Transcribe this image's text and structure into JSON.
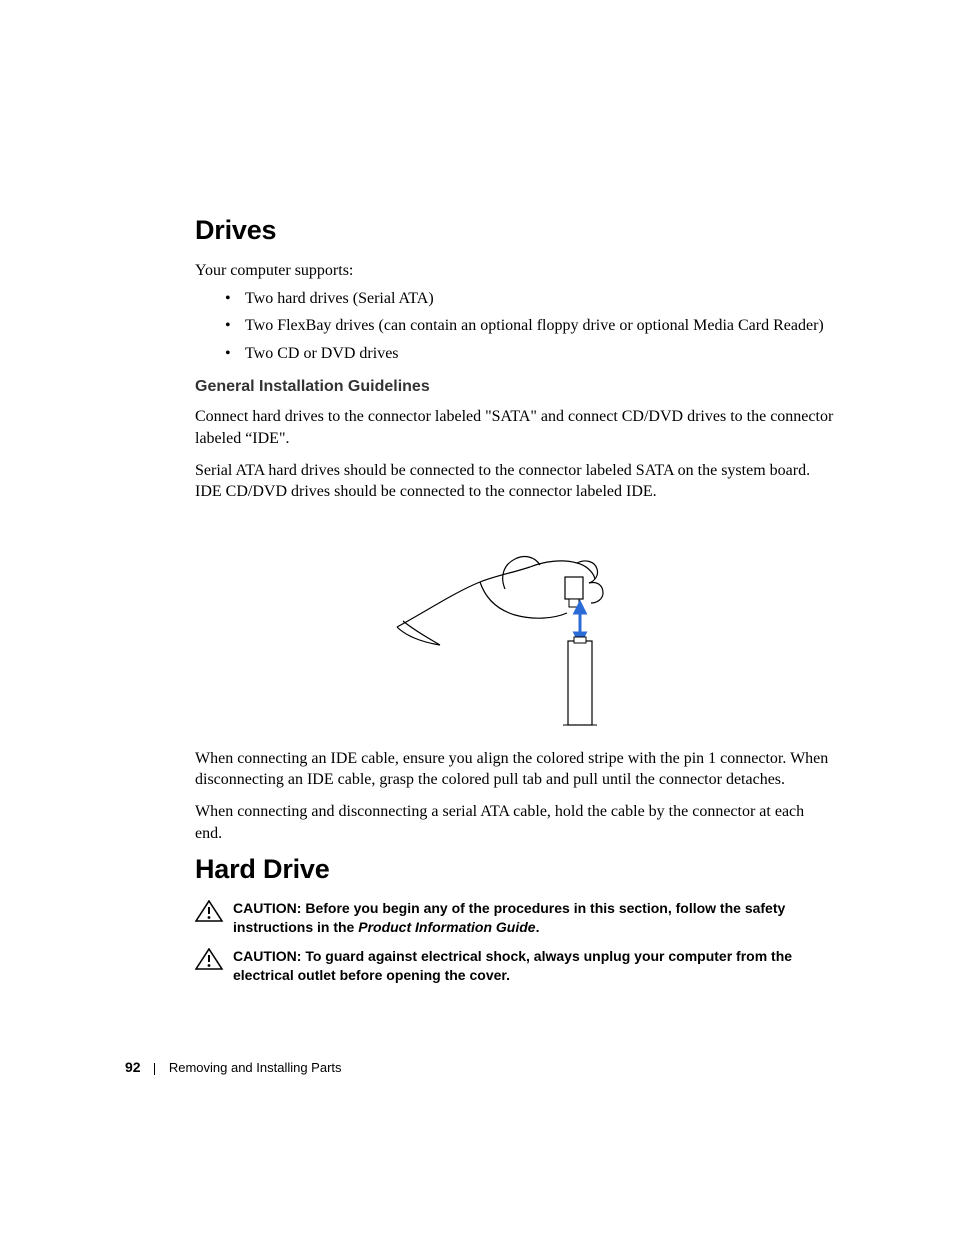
{
  "heading_drives": "Drives",
  "intro": "Your computer supports:",
  "bullets": [
    "Two hard drives (Serial ATA)",
    "Two FlexBay drives (can contain an optional floppy drive or optional Media Card Reader)",
    "Two CD or DVD drives"
  ],
  "subhead_guidelines": "General Installation Guidelines",
  "para1": "Connect hard drives to the connector labeled \"SATA\" and connect CD/DVD drives to the connector labeled “IDE\".",
  "para2": "Serial ATA hard drives should be connected to the connector labeled SATA on the system board. IDE CD/DVD drives should be connected to the connector labeled IDE.",
  "para3": "When connecting an IDE cable, ensure you align the colored stripe with the pin 1 connector. When disconnecting an IDE cable, grasp the colored pull tab and pull until the connector detaches.",
  "para4": "When connecting and disconnecting a serial ATA cable, hold the cable by the connector at each end.",
  "heading_harddrive": "Hard Drive",
  "caution1_label": "CAUTION: ",
  "caution1_text": "Before you begin any of the procedures in this section, follow the safety instructions in the ",
  "caution1_em": "Product Information Guide",
  "caution1_tail": ".",
  "caution2_label": "CAUTION: ",
  "caution2_text": "To guard against electrical shock, always unplug your computer from the electrical outlet before opening the cover.",
  "footer_page": "92",
  "footer_section": "Removing and Installing Parts"
}
